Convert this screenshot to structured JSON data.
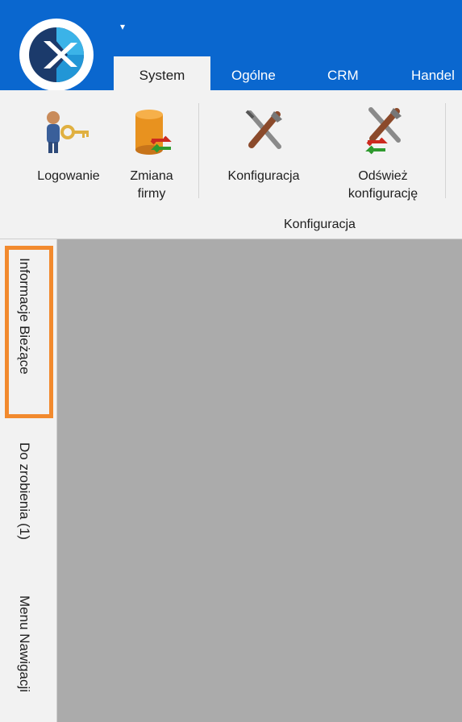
{
  "quick_access": {
    "glyph": "▾"
  },
  "tabs": [
    {
      "label": "System",
      "active": true
    },
    {
      "label": "Ogólne",
      "active": false
    },
    {
      "label": "CRM",
      "active": false
    },
    {
      "label": "Handel",
      "active": false
    }
  ],
  "ribbon": {
    "buttons": [
      {
        "label_lines": [
          "Logowanie"
        ],
        "icon": "user-key-icon"
      },
      {
        "label_lines": [
          "Zmiana",
          "firmy"
        ],
        "icon": "database-switch-icon"
      },
      {
        "label_lines": [
          "Konfiguracja"
        ],
        "icon": "tools-icon"
      },
      {
        "label_lines": [
          "Odśwież",
          "konfigurację"
        ],
        "icon": "tools-refresh-icon"
      }
    ],
    "group_label": "Konfiguracja"
  },
  "side_tabs": [
    {
      "label": "Informacje Bieżące",
      "highlighted": true
    },
    {
      "label": "Do zrobienia (1)",
      "highlighted": false
    },
    {
      "label": "Menu Nawigacji",
      "highlighted": false
    }
  ],
  "colors": {
    "titlebar": "#0a67cf",
    "ribbon": "#f2f2f2",
    "workspace": "#ababab",
    "highlight": "#f28a2e"
  }
}
